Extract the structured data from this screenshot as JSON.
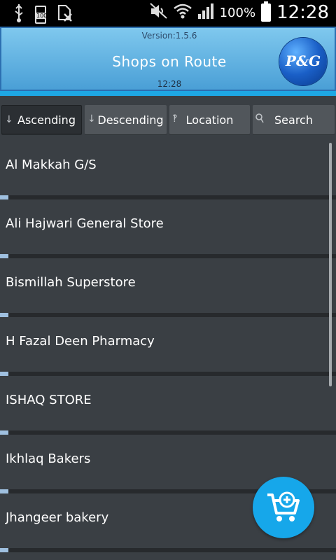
{
  "status_bar": {
    "battery_small_label": "100",
    "battery_percent": "100%",
    "time": "12:28",
    "icons": [
      "usb-icon",
      "battery-100-icon",
      "no-sim-icon",
      "mute-icon",
      "wifi-icon",
      "signal-icon",
      "battery-icon"
    ]
  },
  "header": {
    "version": "Version:1.5.6",
    "title": "Shops on Route",
    "time": "12:28",
    "logo_text": "P&G"
  },
  "toolbar": {
    "ascending": "Ascending",
    "descending": "Descending",
    "location": "Location",
    "search": "Search"
  },
  "shops": [
    {
      "name": "Al Makkah G/S"
    },
    {
      "name": "Ali Hajwari General Store"
    },
    {
      "name": "Bismillah Superstore"
    },
    {
      "name": "H Fazal Deen Pharmacy"
    },
    {
      "name": "ISHAQ STORE"
    },
    {
      "name": "Ikhlaq Bakers"
    },
    {
      "name": "Jhangeer bakery"
    }
  ],
  "fab": {
    "icon": "add-to-cart-icon"
  },
  "colors": {
    "header_gradient_top": "#7fc8ee",
    "header_gradient_bottom": "#4a9fd6",
    "accent": "#1ea7e4",
    "list_bg": "#3a3f44",
    "fab": "#16a7ea"
  }
}
